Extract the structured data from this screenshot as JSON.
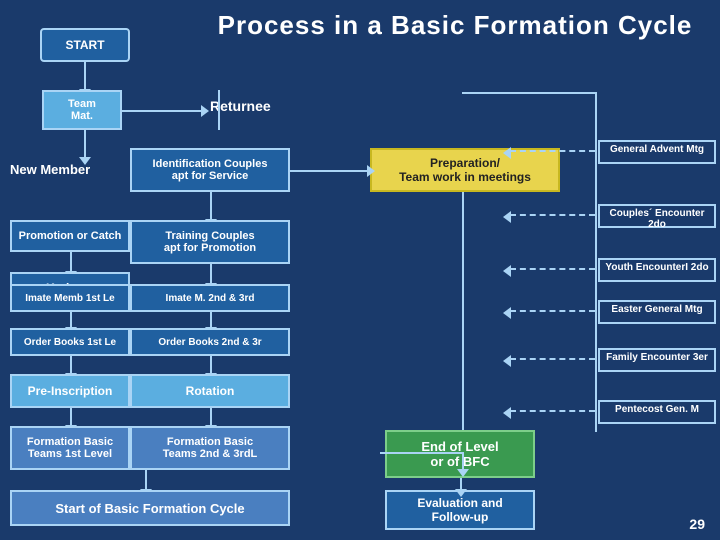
{
  "title": "Process in a Basic  Formation Cycle",
  "start_label": "START",
  "team_mat_label": "Team\nMat.",
  "returnee_label": "Returnee",
  "new_member_label": "New Member",
  "identification_label": "Identification Couples\napt for Service",
  "preparation_label": "Preparation/\nTeam work in meetings",
  "promotion_label": "Promotion or Catch",
  "training_label": "Training Couples\napt for Promotion",
  "kerigma_label": "Kerigma",
  "intimate_memb_label": "Imate Memb 1st Le",
  "intimate_m_2nd_label": "Imate M. 2nd & 3rd",
  "order_books_1_label": "Order Books  1st Le",
  "order_books_2_label": "Order Books 2nd & 3r",
  "pre_inscription_label": "Pre-Inscription",
  "rotation_label": "Rotation",
  "formation_basic_1_label": "Formation Basic\nTeams 1st Level",
  "formation_basic_2_label": "Formation Basic\nTeams 2nd & 3rdL",
  "start_cycle_label": "Start of  Basic Formation Cycle",
  "general_advent_label": "General Advent Mtg",
  "couples_encounter_label": "Couples´ Encounter 2do",
  "youth_encounter_label": "Youth EncounterI 2do",
  "easter_general_label": "Easter General Mtg",
  "family_encounter_label": "Family Encounter 3er",
  "pentecost_label": "Pentecost Gen. M",
  "end_level_label": "End of Level\nor of BFC",
  "evaluation_label": "Evaluation and\nFollow-up",
  "page_number": "29"
}
